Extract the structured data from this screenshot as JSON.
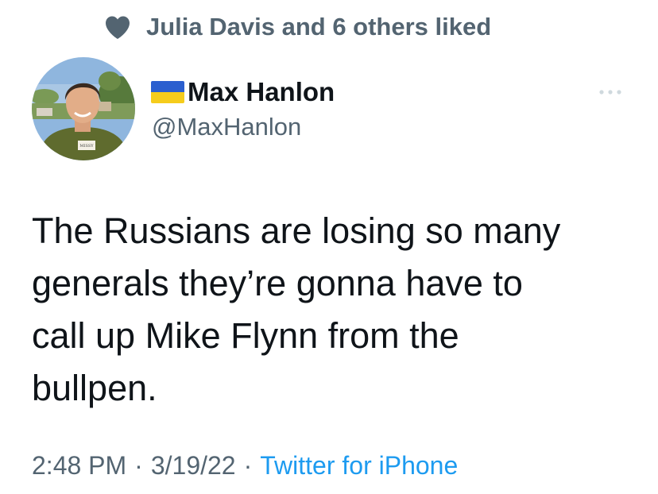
{
  "social_context": {
    "text": "Julia Davis and 6 others liked",
    "icon": "heart-icon"
  },
  "author": {
    "flag_icon": "ukraine-flag-icon",
    "name": "Max Hanlon",
    "handle": "@MaxHanlon",
    "avatar_badge": "MISSY"
  },
  "tweet": {
    "lines": [
      "The Russians are losing so many",
      "generals they’re gonna have to",
      "call up Mike Flynn from the",
      "bullpen."
    ]
  },
  "meta": {
    "time": "2:48 PM",
    "separator": "·",
    "date": "3/19/22",
    "source": "Twitter for iPhone"
  },
  "colors": {
    "text_primary": "#0f1419",
    "text_secondary": "#536471",
    "link": "#1d9bf0",
    "flag_blue": "#2b5fcf",
    "flag_yellow": "#f5cc1c"
  }
}
